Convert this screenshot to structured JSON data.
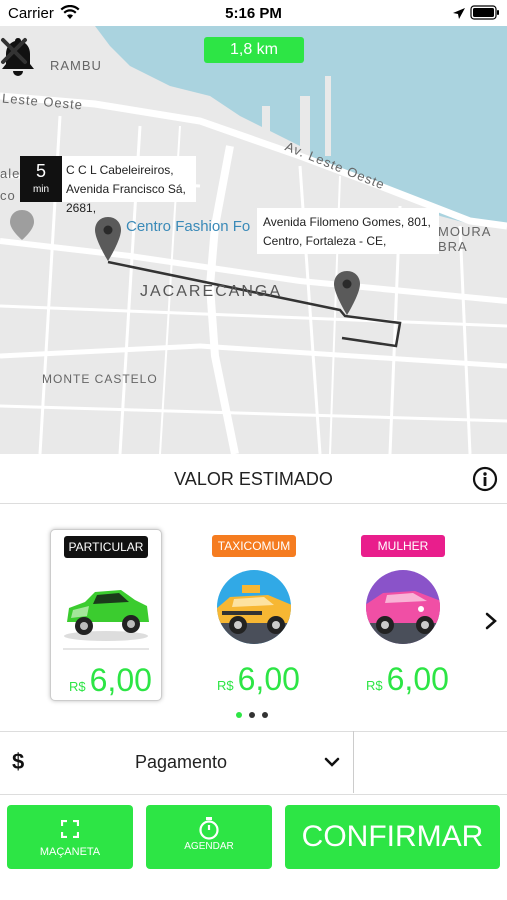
{
  "status_bar": {
    "carrier": "Carrier",
    "time": "5:16 PM"
  },
  "map": {
    "distance": "1,8 km",
    "labels": {
      "rambu": "RAMBU",
      "leste_oeste_1": "Leste Oeste",
      "av_leste_oeste": "Av. Leste Oeste",
      "ale": "ale",
      "co": "co",
      "centro_fashion": "Centro Fashion Fo",
      "jacarecanga": "JACARECANGA",
      "moura_bra": "MOURA BRA",
      "monte_castelo": "MONTE CASTELO"
    },
    "eta": {
      "value": "5",
      "unit": "min"
    },
    "origin_address": {
      "line1": "C C L Cabeleireiros,",
      "line2": "Avenida Francisco Sá, 2681,"
    },
    "destination_address": {
      "line1": "Avenida Filomeno Gomes, 801,",
      "line2": "Centro, Fortaleza - CE,"
    }
  },
  "estimate": {
    "title": "VALOR ESTIMADO"
  },
  "categories": [
    {
      "badge": "PARTICULAR",
      "badge_color": "#111111",
      "currency": "R$",
      "price": "6,00",
      "selected": true
    },
    {
      "badge": "TAXICOMUM",
      "badge_color": "#f57c20",
      "currency": "R$",
      "price": "6,00",
      "selected": false
    },
    {
      "badge": "MULHER",
      "badge_color": "#e91e8c",
      "currency": "R$",
      "price": "6,00",
      "selected": false
    }
  ],
  "pagination": {
    "active": 1,
    "total": 3
  },
  "payment": {
    "icon": "$",
    "label": "Pagamento"
  },
  "actions": {
    "macaneta": "MAÇANETA",
    "agendar": "AGENDAR",
    "confirmar": "CONFIRMAR"
  },
  "colors": {
    "accent": "#2de545",
    "map_bg": "#e9e9e9",
    "water": "#aad3df"
  }
}
